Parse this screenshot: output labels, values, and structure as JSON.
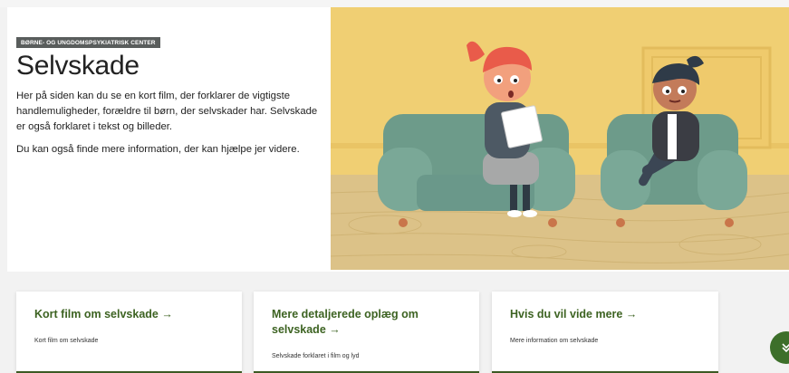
{
  "hero": {
    "category_badge": "BØRNE- OG UNGDOMSPSYKIATRISK CENTER",
    "title": "Selvskade",
    "paragraphs": [
      "Her på siden kan du se en kort film, der forklarer de vigtigste handlemuligheder, forældre til børn, der selvskader har. Selvskade er også forklaret i tekst og billeder.",
      "Du kan også finde mere information, der kan hjælpe jer videre."
    ]
  },
  "cards": [
    {
      "title": "Kort film om selvskade",
      "arrow": "→",
      "description": "Kort film om selvskade"
    },
    {
      "title": "Mere detaljerede oplæg om selvskade",
      "arrow": "→",
      "description": "Selvskade forklaret i film og lyd"
    },
    {
      "title": "Hvis du vil vide mere",
      "arrow": "→",
      "description": "Mere information om selvskade"
    }
  ],
  "scroll_button": {
    "icon": "double-chevron-down-icon"
  },
  "colors": {
    "accent_green": "#3d6322",
    "badge_gray": "#595d5c",
    "wall_yellow": "#f0cf73",
    "floor_wood": "#dcc288",
    "sofa_teal": "#6d9b8a"
  }
}
